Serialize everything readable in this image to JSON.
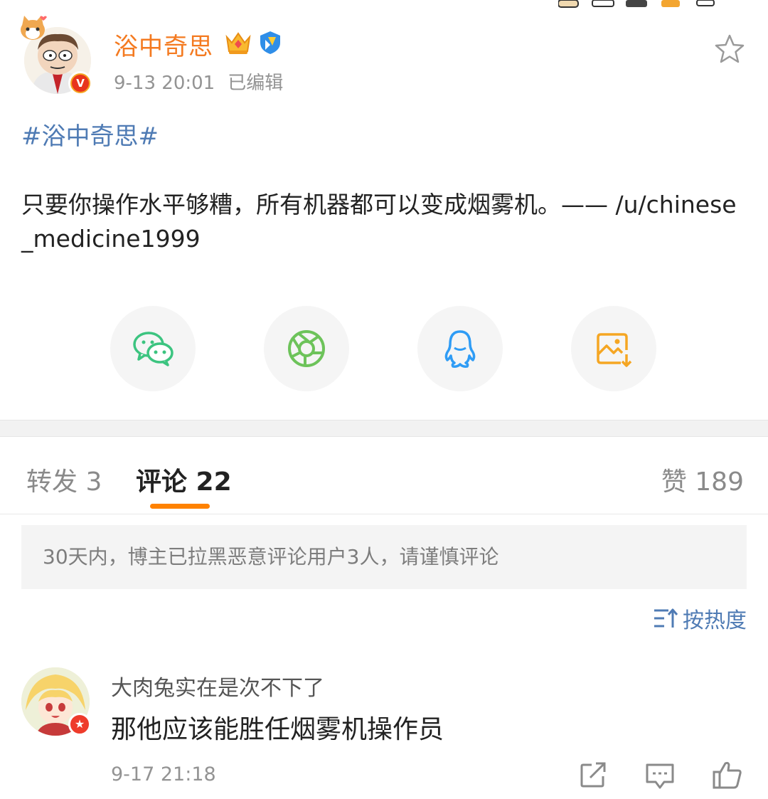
{
  "post": {
    "author": "浴中奇思",
    "time": "9-13 20:01",
    "edited": "已编辑",
    "hashtag": "#浴中奇思#",
    "content": "只要你操作水平够糟，所有机器都可以变成烟雾机。—— /u/chinese_medicine1999"
  },
  "share": {
    "items": [
      {
        "icon": "wechat-icon",
        "color": "#3cc480"
      },
      {
        "icon": "moments-icon",
        "color": "#6dc35a"
      },
      {
        "icon": "qq-icon",
        "color": "#2f9cf5"
      },
      {
        "icon": "save-image-icon",
        "color": "#f5a623"
      }
    ]
  },
  "tabs": {
    "repost": "转发 3",
    "comments": "评论 22",
    "likes": "赞 189",
    "accent_color": "#ff8200"
  },
  "notice": "30天内，博主已拉黑恶意评论用户3人，请谨慎评论",
  "sort": {
    "label": "按热度"
  },
  "comment": {
    "user": "大肉兔实在是次不下了",
    "text": "那他应该能胜任烟雾机操作员",
    "time": "9-17 21:18"
  },
  "colors": {
    "username": "#f47a20",
    "link": "#4f7bb4",
    "muted": "#939393"
  }
}
